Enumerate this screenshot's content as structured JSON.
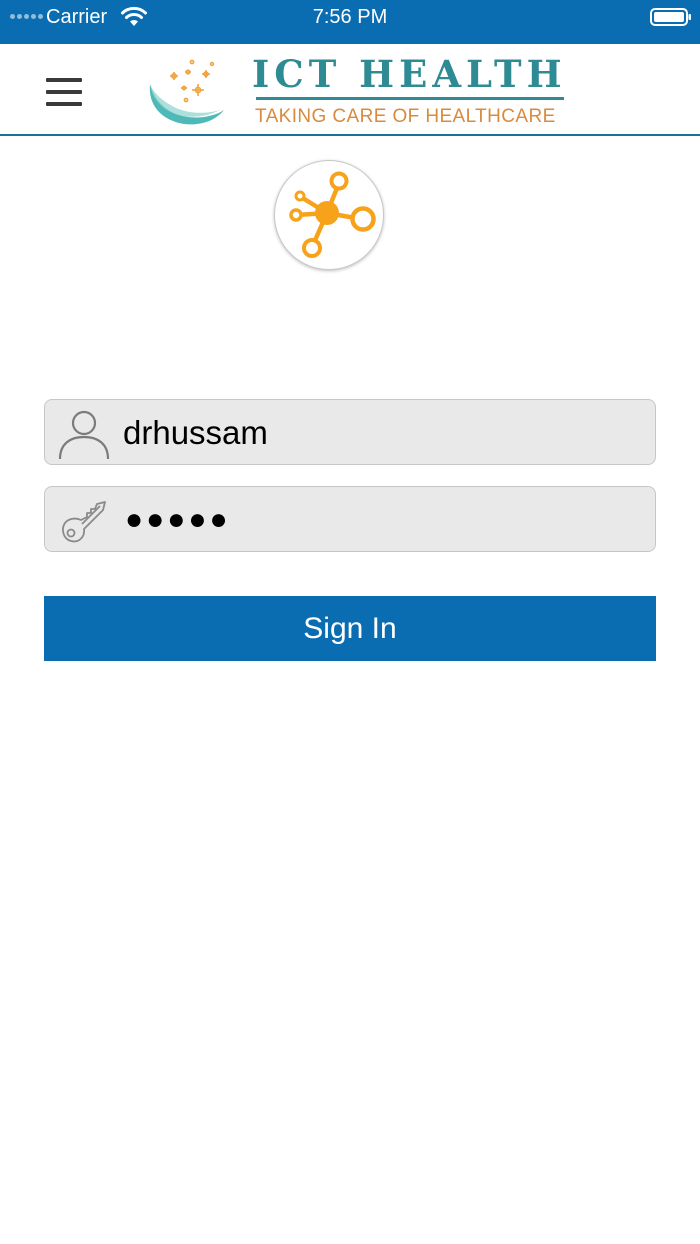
{
  "status_bar": {
    "carrier": "Carrier",
    "time": "7:56 PM",
    "background_color": "#0a6db2",
    "icons": [
      "signal-icon",
      "wifi-icon",
      "battery-icon"
    ]
  },
  "header": {
    "menu_icon": "hamburger-menu-icon",
    "brand_title": "ICT HEALTH",
    "brand_tagline": "TAKING CARE OF HEALTHCARE",
    "brand_title_color": "#2e8a93",
    "brand_tagline_color": "#d98a3c"
  },
  "logo": {
    "icon": "molecule-logo-icon",
    "color": "#f7a21b"
  },
  "login_form": {
    "username": {
      "icon": "user-icon",
      "value": "drhussam"
    },
    "password": {
      "icon": "key-icon",
      "value": "●●●●●"
    },
    "sign_in_label": "Sign In",
    "button_color": "#0a6db2"
  }
}
